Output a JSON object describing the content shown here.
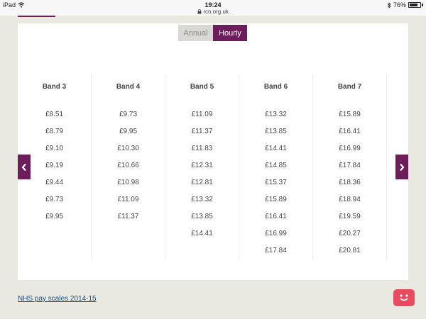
{
  "status_bar": {
    "device": "iPad",
    "time": "19:24",
    "url": "rcn.org.uk",
    "battery": "76%"
  },
  "toggle": {
    "annual_label": "Annual",
    "hourly_label": "Hourly",
    "selected": "Hourly"
  },
  "bands": [
    {
      "title": "Band 3",
      "values": [
        "£8.51",
        "£8.79",
        "£9.10",
        "£9.19",
        "£9.44",
        "£9.73",
        "£9.95"
      ]
    },
    {
      "title": "Band 4",
      "values": [
        "£9.73",
        "£9.95",
        "£10.30",
        "£10.66",
        "£10.98",
        "£11.09",
        "£11.37"
      ]
    },
    {
      "title": "Band 5",
      "values": [
        "£11.09",
        "£11.37",
        "£11.83",
        "£12.31",
        "£12.81",
        "£13.32",
        "£13.85",
        "£14.41"
      ]
    },
    {
      "title": "Band 6",
      "values": [
        "£13.32",
        "£13.85",
        "£14.41",
        "£14.85",
        "£15.37",
        "£15.89",
        "£16.41",
        "£16.99",
        "£17.84"
      ]
    },
    {
      "title": "Band 7",
      "values": [
        "£15.89",
        "£16.41",
        "£16.99",
        "£17.84",
        "£18.36",
        "£18.94",
        "£19.59",
        "£20.27",
        "£20.81"
      ]
    }
  ],
  "footer": {
    "link_text": "NHS pay scales 2014-15"
  },
  "icons": {
    "prev": "chevron-left-icon",
    "next": "chevron-right-icon",
    "chat": "chat-bot-icon"
  },
  "colors": {
    "accent": "#6d1d5a",
    "background": "#e9e8e1",
    "chat": "#e84a5f",
    "link": "#1a4f8a"
  }
}
